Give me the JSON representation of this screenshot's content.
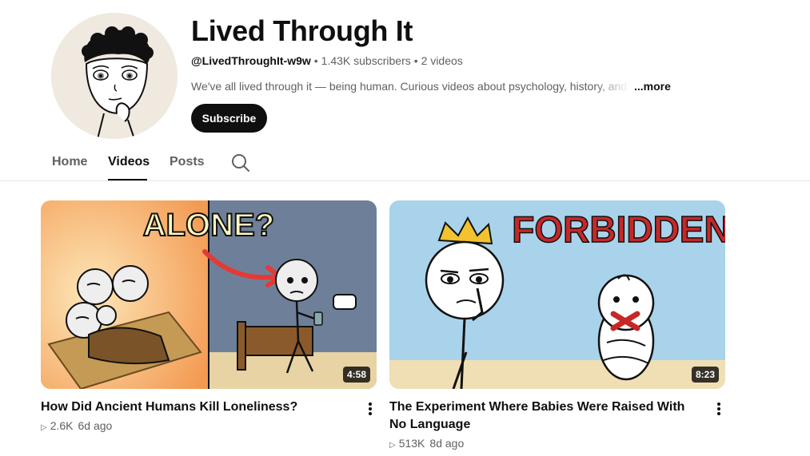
{
  "channel": {
    "name": "Lived Through It",
    "handle": "@LivedThroughIt-w9w",
    "subscribers": "1.43K subscribers",
    "video_count": "2 videos",
    "description": "We've all lived through it — being human. Curious videos about psychology, history, and th",
    "more_label": "...more",
    "subscribe_label": "Subscribe"
  },
  "tabs": [
    {
      "label": "Home"
    },
    {
      "label": "Videos",
      "active": true
    },
    {
      "label": "Posts"
    }
  ],
  "videos": [
    {
      "title": "How Did Ancient Humans Kill Loneliness?",
      "views": "2.6K",
      "age": "6d ago",
      "duration": "4:58",
      "thumbnail_text": "ALONE?"
    },
    {
      "title": "The Experiment Where Babies Were Raised With No Language",
      "views": "513K",
      "age": "8d ago",
      "duration": "8:23",
      "thumbnail_text": "FORBIDDEN"
    }
  ],
  "icons": {
    "search": "search-icon",
    "kebab": "more-vert-icon",
    "play": "play-icon"
  },
  "colors": {
    "primary_text": "#0f0f0f",
    "secondary_text": "#606060",
    "thumb1_left_bg": "#f4a35c",
    "thumb1_right_bg": "#6e8099",
    "thumb2_bg": "#a9d3ea",
    "forbidden_red": "#c62828"
  }
}
